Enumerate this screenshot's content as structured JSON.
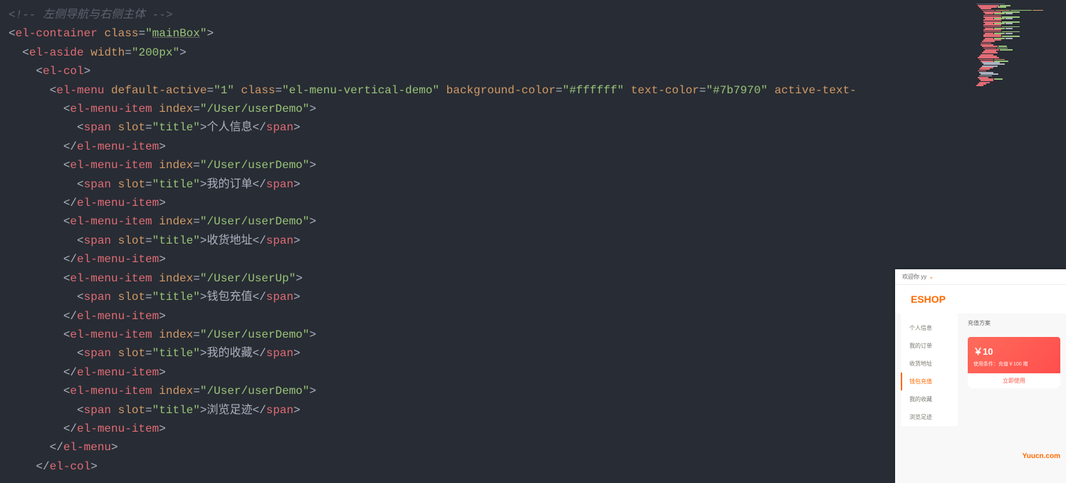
{
  "code": {
    "comment1": "<!-- 左侧导航与右侧主体 -->",
    "line2": {
      "tag": "el-container",
      "attr1": "class",
      "val1": "mainBox"
    },
    "line3": {
      "tag": "el-aside",
      "attr1": "width",
      "val1": "200px"
    },
    "line4": {
      "tag": "el-col"
    },
    "line5": {
      "tag": "el-menu",
      "a1": "default-active",
      "v1": "1",
      "a2": "class",
      "v2": "el-menu-vertical-demo",
      "a3": "background-color",
      "v3": "#ffffff",
      "a4": "text-color",
      "v4": "#7b7970",
      "a5": "active-text-"
    },
    "line6": {
      "tag": "el-menu-item",
      "a1": "index",
      "v1": "/User/userDemo"
    },
    "line7": {
      "tag": "span",
      "a1": "slot",
      "v1": "title",
      "text": "个人信息"
    },
    "line8": {
      "tag": "el-menu-item"
    },
    "line9": {
      "tag": "el-menu-item",
      "a1": "index",
      "v1": "/User/userDemo"
    },
    "line10": {
      "tag": "span",
      "a1": "slot",
      "v1": "title",
      "text": "我的订单"
    },
    "line11": {
      "tag": "el-menu-item"
    },
    "line12": {
      "tag": "el-menu-item",
      "a1": "index",
      "v1": "/User/userDemo"
    },
    "line13": {
      "tag": "span",
      "a1": "slot",
      "v1": "title",
      "text": "收货地址"
    },
    "line14": {
      "tag": "el-menu-item"
    },
    "line15": {
      "tag": "el-menu-item",
      "a1": "index",
      "v1": "/User/UserUp"
    },
    "line16": {
      "tag": "span",
      "a1": "slot",
      "v1": "title",
      "text": "钱包充值"
    },
    "line17": {
      "tag": "el-menu-item"
    },
    "line18": {
      "tag": "el-menu-item",
      "a1": "index",
      "v1": "/User/userDemo"
    },
    "line19": {
      "tag": "span",
      "a1": "slot",
      "v1": "title",
      "text": "我的收藏"
    },
    "line20": {
      "tag": "el-menu-item"
    },
    "line21": {
      "tag": "el-menu-item",
      "a1": "index",
      "v1": "/User/userDemo"
    },
    "line22": {
      "tag": "span",
      "a1": "slot",
      "v1": "title",
      "text": "浏览足迹"
    },
    "line23": {
      "tag": "el-menu-item"
    },
    "line24": {
      "tag": "el-menu"
    },
    "line25": {
      "tag": "el-col"
    }
  },
  "preview": {
    "welcome": "欢迎你",
    "user": " yy ",
    "chevron": "⌄",
    "logo": "ESHOP",
    "sidebar": [
      {
        "label": "个人信息",
        "active": false
      },
      {
        "label": "我的订单",
        "active": false
      },
      {
        "label": "收货地址",
        "active": false
      },
      {
        "label": "钱包充值",
        "active": true
      },
      {
        "label": "我的收藏",
        "active": false
      },
      {
        "label": "浏览足迹",
        "active": false
      }
    ],
    "main_title": "充值方案",
    "card_price": "￥10",
    "card_desc": "使用条件：充值￥100 赠",
    "card_btn": "立即使用",
    "watermark": "Yuucn.com"
  }
}
